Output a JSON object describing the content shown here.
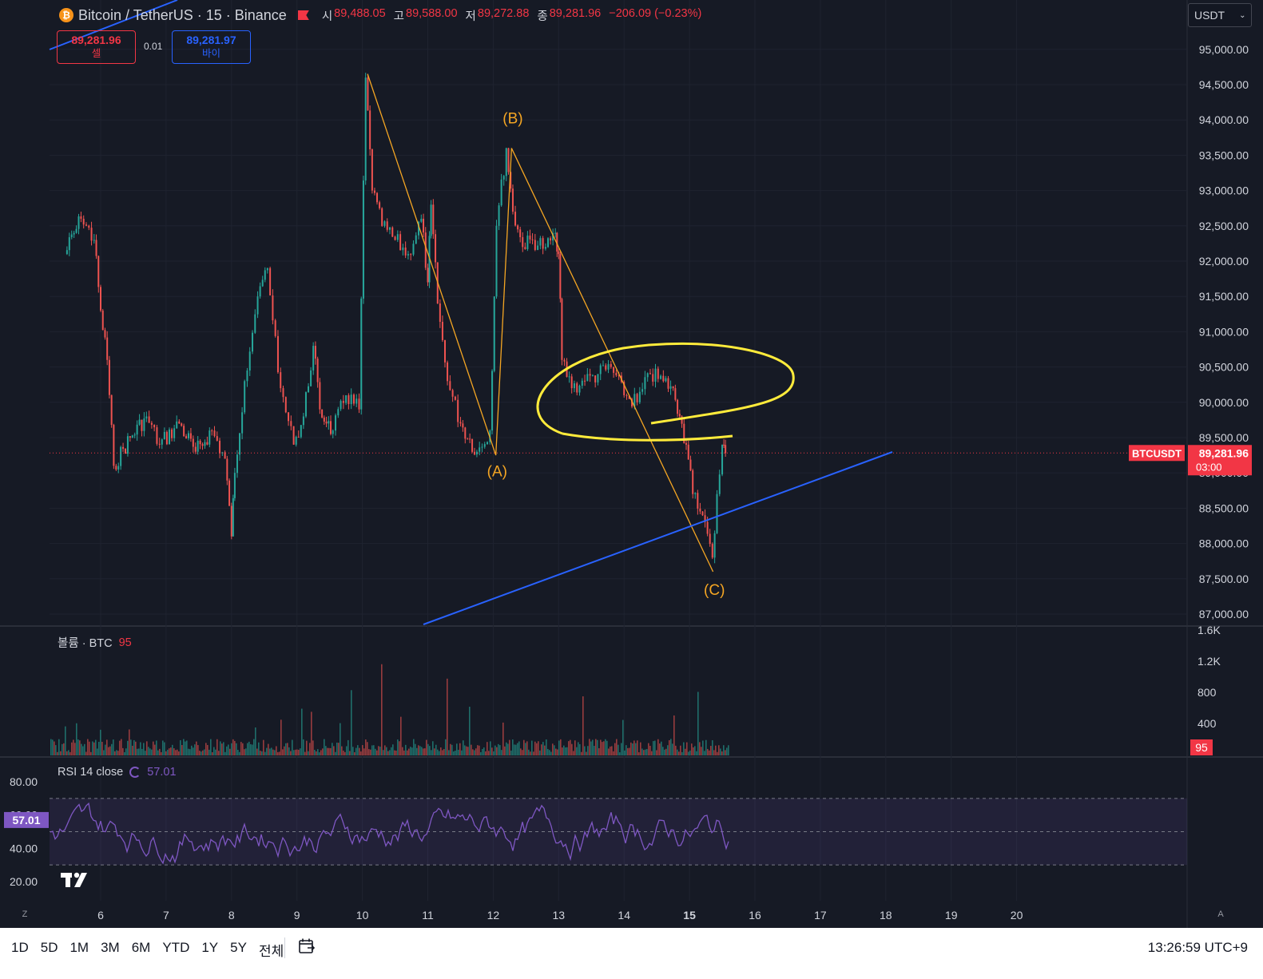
{
  "header": {
    "coin_glyph": "₿",
    "symbol": "Bitcoin / TetherUS · 15 · Binance",
    "ohlc": [
      {
        "label": "시",
        "value": "89,488.05"
      },
      {
        "label": "고",
        "value": "89,588.00"
      },
      {
        "label": "저",
        "value": "89,272.88"
      },
      {
        "label": "종",
        "value": "89,281.96"
      },
      {
        "label": "",
        "value": "−206.09 (−0.23%)"
      }
    ]
  },
  "trade": {
    "sell_price": "89,281.96",
    "sell_label": "셀",
    "spread": "0.01",
    "buy_price": "89,281.97",
    "buy_label": "바이"
  },
  "currency_selector": "USDT",
  "price_axis": {
    "ticks": [
      "95,000.00",
      "94,500.00",
      "94,000.00",
      "93,500.00",
      "93,000.00",
      "92,500.00",
      "92,000.00",
      "91,500.00",
      "91,000.00",
      "90,500.00",
      "90,000.00",
      "89,500.00",
      "89,000.00",
      "88,500.00",
      "88,000.00",
      "87,500.00",
      "87,000.00"
    ],
    "current_symbol": "BTCUSDT",
    "current_price": "89,281.96",
    "countdown": "03:00"
  },
  "chart_data": {
    "type": "line",
    "title": "Bitcoin / TetherUS · 15 · Binance",
    "x_ticks": [
      "6",
      "7",
      "8",
      "9",
      "10",
      "11",
      "12",
      "13",
      "14",
      "15",
      "16",
      "17",
      "18",
      "19",
      "20"
    ],
    "ylim": [
      86800,
      95100
    ],
    "series": [
      {
        "name": "BTCUSDT",
        "x": [
          5.45,
          5.7,
          5.9,
          6.0,
          6.1,
          6.2,
          6.45,
          6.7,
          6.9,
          7.2,
          7.45,
          7.7,
          7.9,
          8.0,
          8.05,
          8.2,
          8.4,
          8.55,
          8.75,
          8.95,
          9.1,
          9.25,
          9.35,
          9.45,
          9.55,
          9.75,
          9.95,
          10.05,
          10.15,
          10.3,
          10.5,
          10.7,
          10.9,
          11.0,
          11.05,
          11.15,
          11.3,
          11.5,
          11.75,
          11.95,
          12.05,
          12.2,
          12.3,
          12.45,
          12.6,
          12.8,
          12.95,
          13.0,
          13.05,
          13.2,
          13.4,
          13.6,
          13.8,
          14.0,
          14.2,
          14.4,
          14.6,
          14.75,
          14.85,
          14.95,
          15.05,
          15.2,
          15.35,
          15.42,
          15.5,
          15.55
        ],
        "y": [
          92100,
          92600,
          92300,
          91300,
          90600,
          89100,
          89500,
          89800,
          89400,
          89700,
          89300,
          89600,
          89200,
          88100,
          89000,
          90300,
          91500,
          91900,
          90200,
          89400,
          89800,
          90800,
          89900,
          89700,
          89600,
          90100,
          89900,
          94600,
          93000,
          92500,
          92300,
          92100,
          92600,
          91700,
          92800,
          91400,
          90300,
          89700,
          89300,
          89600,
          92500,
          93600,
          92700,
          92200,
          92300,
          92200,
          92400,
          92100,
          90600,
          90200,
          90300,
          90400,
          90500,
          90100,
          90000,
          90400,
          90300,
          90200,
          89800,
          89400,
          88700,
          88400,
          87800,
          88700,
          89400,
          89280
        ]
      }
    ],
    "wave_labels": [
      "(A)",
      "(B)",
      "(C)"
    ],
    "volume": {
      "label": "볼륨 · BTC",
      "last": "95",
      "axis_ticks": [
        "1.6K",
        "1.2K",
        "800",
        "400"
      ]
    },
    "rsi": {
      "label": "RSI 14 close",
      "last": "57.01",
      "axis_ticks": [
        "80.00",
        "60.00",
        "40.00",
        "20.00"
      ]
    }
  },
  "corners": {
    "z_label": "Z",
    "a_label": "A"
  },
  "timeframes": [
    "1D",
    "5D",
    "1M",
    "3M",
    "6M",
    "YTD",
    "1Y",
    "5Y",
    "전체"
  ],
  "clock": "13:26:59 UTC+9"
}
